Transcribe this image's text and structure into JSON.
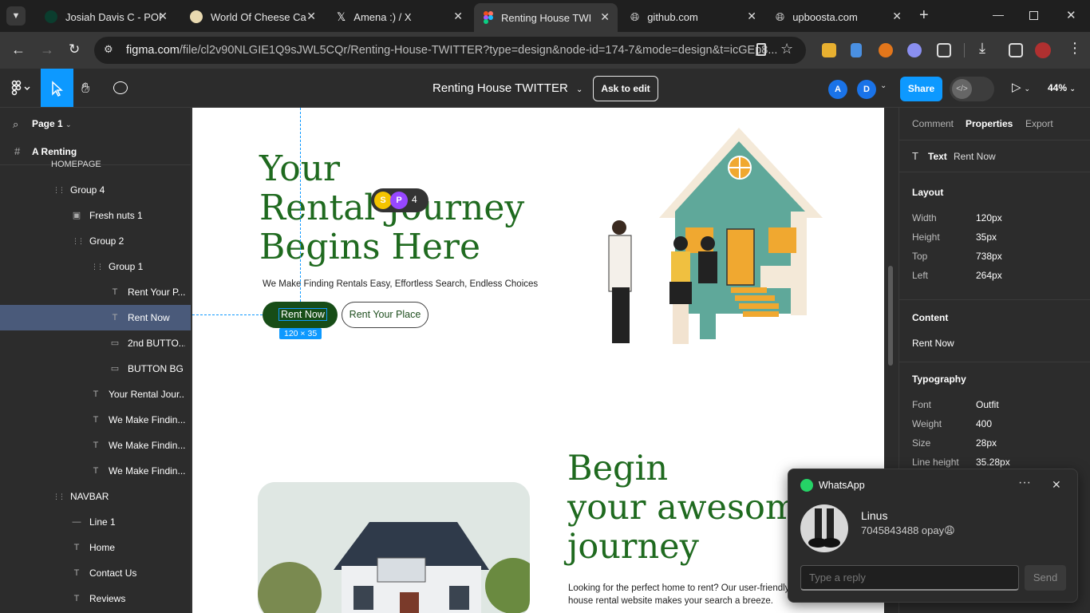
{
  "browser": {
    "tabs": [
      {
        "title": "Josiah Davis C - PORT",
        "active": false
      },
      {
        "title": "World Of Cheese Cak",
        "active": false
      },
      {
        "title": "Amena :) / X",
        "active": false
      },
      {
        "title": "Renting House TWITT",
        "active": true
      },
      {
        "title": "github.com",
        "active": false
      },
      {
        "title": "upboosta.com",
        "active": false
      }
    ],
    "url_domain": "figma.com",
    "url_path": "/file/cl2v90NLGIE1Q9sJWL5CQr/Renting-House-TWITTER?type=design&node-id=174-7&mode=design&t=icGEp8..."
  },
  "figma": {
    "file_title": "Renting House TWITTER",
    "ask_to_edit": "Ask to edit",
    "avatars": [
      "A",
      "D"
    ],
    "share_label": "Share",
    "zoom": "44%"
  },
  "layers": {
    "page_label": "Page 1",
    "frame_label": "A Renting",
    "partial_label": "HOMEPAGE",
    "items": [
      {
        "label": "Group 4",
        "indent": 1,
        "icon": "group"
      },
      {
        "label": "Fresh nuts 1",
        "indent": 2,
        "icon": "image"
      },
      {
        "label": "Group 2",
        "indent": 2,
        "icon": "group"
      },
      {
        "label": "Group 1",
        "indent": 3,
        "icon": "group"
      },
      {
        "label": "Rent Your P...",
        "indent": 4,
        "icon": "text"
      },
      {
        "label": "Rent Now",
        "indent": 4,
        "icon": "text",
        "selected": true
      },
      {
        "label": "2nd BUTTO...",
        "indent": 4,
        "icon": "rect"
      },
      {
        "label": "BUTTON BG",
        "indent": 4,
        "icon": "rect"
      },
      {
        "label": "Your Rental Jour...",
        "indent": 3,
        "icon": "text"
      },
      {
        "label": "We Make Findin...",
        "indent": 3,
        "icon": "text"
      },
      {
        "label": "We Make Findin...",
        "indent": 3,
        "icon": "text"
      },
      {
        "label": "We Make Findin...",
        "indent": 3,
        "icon": "text"
      },
      {
        "label": "NAVBAR",
        "indent": 1,
        "icon": "group"
      },
      {
        "label": "Line 1",
        "indent": 2,
        "icon": "line"
      },
      {
        "label": "Home",
        "indent": 2,
        "icon": "text"
      },
      {
        "label": "Contact Us",
        "indent": 2,
        "icon": "text"
      },
      {
        "label": "Reviews",
        "indent": 2,
        "icon": "text"
      }
    ]
  },
  "canvas": {
    "hero_line1": "Your",
    "hero_line2": "Rental Journey",
    "hero_line3": "Begins Here",
    "subtitle": "We Make Finding Rentals Easy, Effortless Search, Endless Choices",
    "rent_now": "Rent Now",
    "rent_your_place": "Rent Your Place",
    "selection_size": "120 × 35",
    "collaborators": [
      "S",
      "P"
    ],
    "collaborator_count": "4",
    "section2_line1": "Begin",
    "section2_line2": "your awesome",
    "section2_line3": "journey",
    "section2_para_line1": "Looking for the perfect home to rent? Our user-friendly",
    "section2_para_line2": "house rental website makes your search a breeze."
  },
  "properties": {
    "tabs": [
      "Comment",
      "Properties",
      "Export"
    ],
    "layer_type": "Text",
    "layer_name": "Rent Now",
    "layout_title": "Layout",
    "layout": [
      {
        "label": "Width",
        "value": "120px"
      },
      {
        "label": "Height",
        "value": "35px"
      },
      {
        "label": "Top",
        "value": "738px"
      },
      {
        "label": "Left",
        "value": "264px"
      }
    ],
    "content_title": "Content",
    "content_value": "Rent Now",
    "typography_title": "Typography",
    "typography": [
      {
        "label": "Font",
        "value": "Outfit"
      },
      {
        "label": "Weight",
        "value": "400"
      },
      {
        "label": "Size",
        "value": "28px"
      },
      {
        "label": "Line height",
        "value": "35.28px"
      }
    ]
  },
  "whatsapp": {
    "app_name": "WhatsApp",
    "sender": "Linus",
    "message": "7045843488 opay😩",
    "reply_placeholder": "Type a reply",
    "send_label": "Send"
  },
  "colors": {
    "accent": "#0d99ff",
    "brand_green": "#1f6a1f",
    "button_dark_green": "#174d17",
    "selected_layer": "#4a5a7a"
  }
}
